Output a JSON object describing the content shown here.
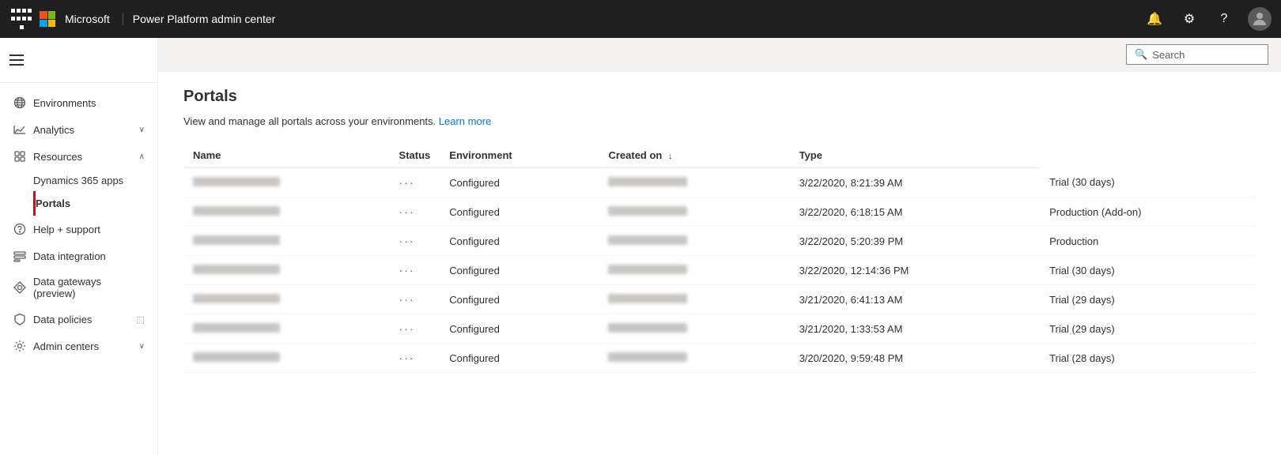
{
  "topbar": {
    "brand": "Microsoft",
    "title": "Power Platform admin center",
    "search_label": "Search"
  },
  "sidebar": {
    "hamburger_label": "Menu",
    "items": [
      {
        "id": "environments",
        "label": "Environments",
        "icon": "globe-icon",
        "has_chevron": false
      },
      {
        "id": "analytics",
        "label": "Analytics",
        "icon": "chart-icon",
        "has_chevron": true,
        "expanded": true
      },
      {
        "id": "resources",
        "label": "Resources",
        "icon": "resources-icon",
        "has_chevron": true,
        "expanded": true
      },
      {
        "id": "dynamics365",
        "label": "Dynamics 365 apps",
        "icon": "",
        "sub": true
      },
      {
        "id": "portals",
        "label": "Portals",
        "icon": "",
        "sub": true,
        "active": true
      },
      {
        "id": "help-support",
        "label": "Help + support",
        "icon": "help-icon",
        "has_chevron": false
      },
      {
        "id": "data-integration",
        "label": "Data integration",
        "icon": "data-int-icon",
        "has_chevron": false
      },
      {
        "id": "data-gateways",
        "label": "Data gateways (preview)",
        "icon": "gateway-icon",
        "has_chevron": false
      },
      {
        "id": "data-policies",
        "label": "Data policies",
        "icon": "policy-icon",
        "has_chevron": false,
        "external": true
      },
      {
        "id": "admin-centers",
        "label": "Admin centers",
        "icon": "admin-icon",
        "has_chevron": true
      }
    ]
  },
  "content": {
    "page_title": "Portals",
    "page_desc": "View and manage all portals across your environments.",
    "learn_more": "Learn more",
    "table": {
      "columns": [
        {
          "id": "name",
          "label": "Name"
        },
        {
          "id": "status",
          "label": "Status"
        },
        {
          "id": "environment",
          "label": "Environment"
        },
        {
          "id": "created_on",
          "label": "Created on",
          "sortable": true
        },
        {
          "id": "type",
          "label": "Type"
        }
      ],
      "rows": [
        {
          "name_blurred": true,
          "status": "Configured",
          "env_blurred": true,
          "created_on": "3/22/2020, 8:21:39 AM",
          "type": "Trial (30 days)"
        },
        {
          "name_blurred": true,
          "status": "Configured",
          "env_blurred": true,
          "created_on": "3/22/2020, 6:18:15 AM",
          "type": "Production (Add-on)"
        },
        {
          "name_blurred": true,
          "status": "Configured",
          "env_blurred": true,
          "created_on": "3/22/2020, 5:20:39 PM",
          "type": "Production"
        },
        {
          "name_blurred": true,
          "status": "Configured",
          "env_blurred": true,
          "created_on": "3/22/2020, 12:14:36 PM",
          "type": "Trial (30 days)"
        },
        {
          "name_blurred": true,
          "status": "Configured",
          "env_blurred": true,
          "created_on": "3/21/2020, 6:41:13 AM",
          "type": "Trial (29 days)"
        },
        {
          "name_blurred": true,
          "status": "Configured",
          "env_blurred": true,
          "created_on": "3/21/2020, 1:33:53 AM",
          "type": "Trial (29 days)"
        },
        {
          "name_blurred": true,
          "status": "Configured",
          "env_blurred": true,
          "created_on": "3/20/2020, 9:59:48 PM",
          "type": "Trial (28 days)"
        }
      ]
    }
  }
}
